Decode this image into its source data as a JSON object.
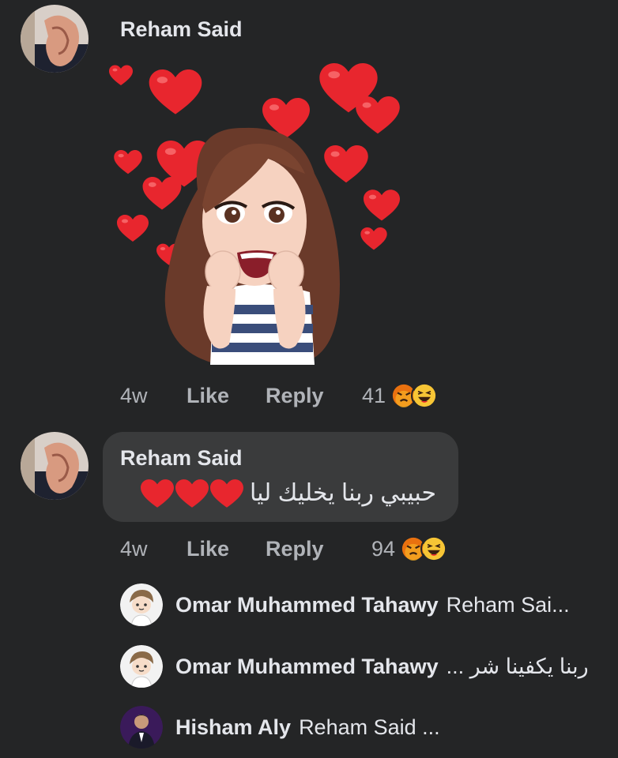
{
  "comment1": {
    "author": "Reham Said",
    "time": "4w",
    "like_label": "Like",
    "reply_label": "Reply",
    "reaction_count": "41",
    "reactions": [
      "angry-react-icon",
      "haha-react-icon"
    ]
  },
  "comment2": {
    "author": "Reham Said",
    "text": "حبيبي ربنا يخليك ليا",
    "time": "4w",
    "like_label": "Like",
    "reply_label": "Reply",
    "reaction_count": "94",
    "reactions": [
      "angry-react-icon",
      "haha-react-icon"
    ]
  },
  "replies": [
    {
      "author": "Omar Muhammed Tahawy",
      "preview": "Reham Sai..."
    },
    {
      "author": "Omar Muhammed Tahawy",
      "preview": "ربنا يكفينا شر ..."
    },
    {
      "author": "Hisham Aly",
      "preview": "Reham Said ..."
    }
  ],
  "colors": {
    "background": "#242526",
    "bubble": "#3a3b3c",
    "text": "#e4e6eb",
    "secondary_text": "#b0b3b8",
    "heart": "#e8262e"
  }
}
